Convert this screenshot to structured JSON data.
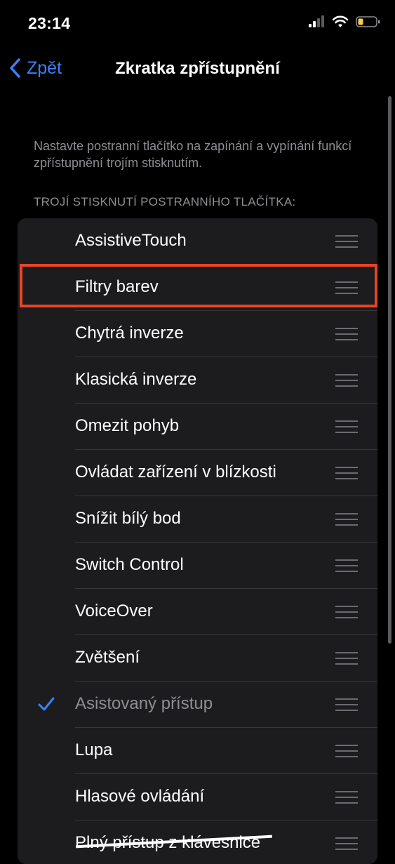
{
  "status_bar": {
    "time": "23:14"
  },
  "nav": {
    "back_label": "Zpět",
    "title": "Zkratka zpřístupnění"
  },
  "description": "Nastavte postranní tlačítko na zapínání a vypínání funkcí zpřístupnění trojím stisknutím.",
  "section_header": "TROJÍ STISKNUTÍ POSTRANNÍHO TLAČÍTKA:",
  "items": [
    {
      "label": "AssistiveTouch",
      "checked": false
    },
    {
      "label": "Filtry barev",
      "checked": false,
      "highlighted": true
    },
    {
      "label": "Chytrá inverze",
      "checked": false
    },
    {
      "label": "Klasická inverze",
      "checked": false
    },
    {
      "label": "Omezit pohyb",
      "checked": false
    },
    {
      "label": "Ovládat zařízení v blízkosti",
      "checked": false
    },
    {
      "label": "Snížit bílý bod",
      "checked": false
    },
    {
      "label": "Switch Control",
      "checked": false
    },
    {
      "label": "VoiceOver",
      "checked": false
    },
    {
      "label": "Zvětšení",
      "checked": false
    },
    {
      "label": "Asistovaný přístup",
      "checked": true,
      "dimmed": true
    },
    {
      "label": "Lupa",
      "checked": false
    },
    {
      "label": "Hlasové ovládání",
      "checked": false
    },
    {
      "label": "Plný přístup z klávesnice",
      "checked": false
    }
  ],
  "colors": {
    "accent": "#3a82f7",
    "highlight": "#e84425",
    "background": "#000000",
    "cell": "#1c1c1e"
  }
}
